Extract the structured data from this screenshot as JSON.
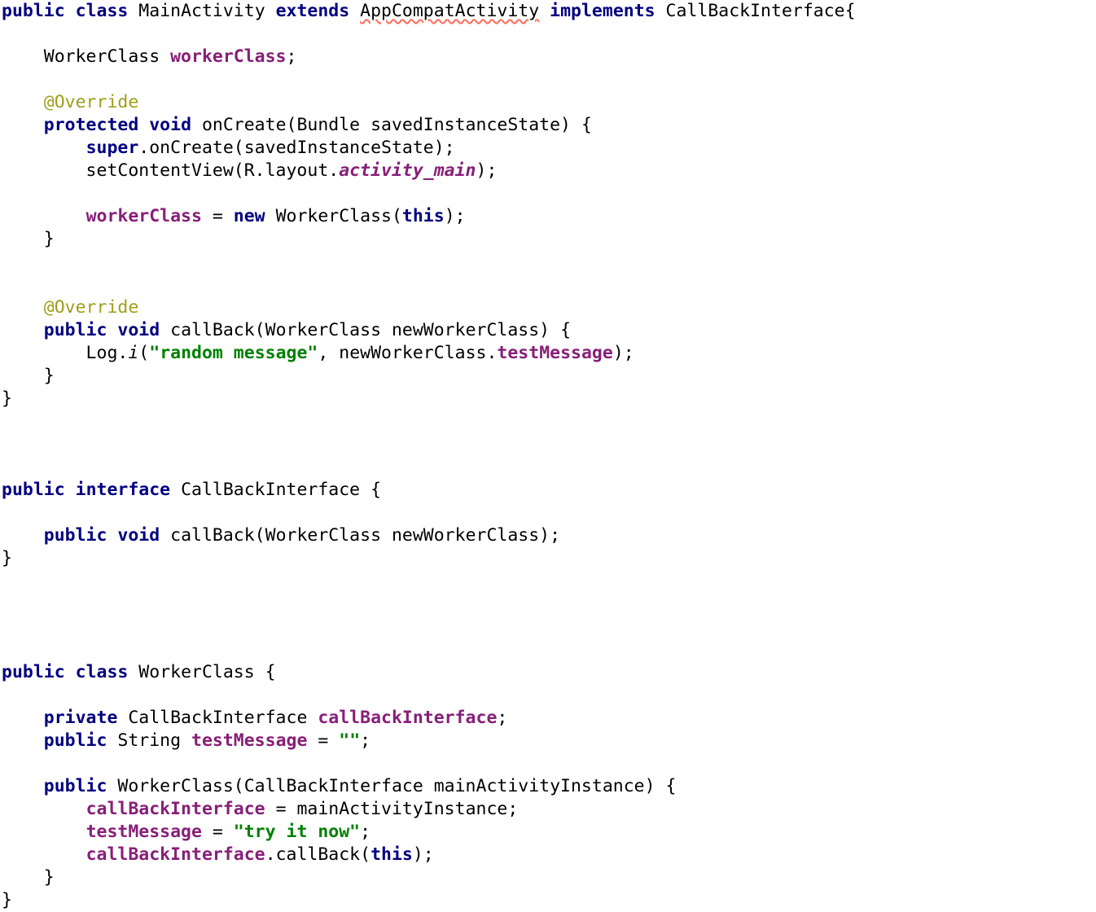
{
  "editor": {
    "language": "java",
    "background_color": "#ffffff",
    "font_size_px": 21.5,
    "line_height_px": 28,
    "theme": "light"
  },
  "colors": {
    "keyword": "#000080",
    "field": "#871F78",
    "static_field": "#871F78",
    "string": "#008000",
    "annotation": "#9E9E1A",
    "plain_text": "#000000",
    "error_squiggle": "#FF6B5A"
  },
  "code": {
    "lines": [
      {
        "n": 1,
        "tokens": [
          {
            "t": "public",
            "c": "kw"
          },
          {
            "t": " ",
            "c": "plain"
          },
          {
            "t": "class",
            "c": "kw"
          },
          {
            "t": " MainActivity ",
            "c": "plain"
          },
          {
            "t": "extends",
            "c": "kw"
          },
          {
            "t": " ",
            "c": "plain"
          },
          {
            "t": "AppCompatActivity",
            "c": "err"
          },
          {
            "t": " ",
            "c": "plain"
          },
          {
            "t": "implements",
            "c": "kw"
          },
          {
            "t": " CallBackInterface{",
            "c": "plain"
          }
        ]
      },
      {
        "n": 2,
        "tokens": []
      },
      {
        "n": 3,
        "tokens": [
          {
            "t": "    WorkerClass ",
            "c": "plain"
          },
          {
            "t": "workerClass",
            "c": "field"
          },
          {
            "t": ";",
            "c": "plain"
          }
        ]
      },
      {
        "n": 4,
        "tokens": []
      },
      {
        "n": 5,
        "tokens": [
          {
            "t": "    ",
            "c": "plain"
          },
          {
            "t": "@Override",
            "c": "anno"
          }
        ]
      },
      {
        "n": 6,
        "tokens": [
          {
            "t": "    ",
            "c": "plain"
          },
          {
            "t": "protected",
            "c": "kw"
          },
          {
            "t": " ",
            "c": "plain"
          },
          {
            "t": "void",
            "c": "kw"
          },
          {
            "t": " onCreate(Bundle savedInstanceState) {",
            "c": "plain"
          }
        ]
      },
      {
        "n": 7,
        "tokens": [
          {
            "t": "        ",
            "c": "plain"
          },
          {
            "t": "super",
            "c": "kw"
          },
          {
            "t": ".onCreate(savedInstanceState);",
            "c": "plain"
          }
        ]
      },
      {
        "n": 8,
        "tokens": [
          {
            "t": "        setContentView(R.layout.",
            "c": "plain"
          },
          {
            "t": "activity_main",
            "c": "static"
          },
          {
            "t": ");",
            "c": "plain"
          }
        ]
      },
      {
        "n": 9,
        "tokens": []
      },
      {
        "n": 10,
        "tokens": [
          {
            "t": "        ",
            "c": "plain"
          },
          {
            "t": "workerClass",
            "c": "field"
          },
          {
            "t": " = ",
            "c": "plain"
          },
          {
            "t": "new",
            "c": "kw"
          },
          {
            "t": " WorkerClass(",
            "c": "plain"
          },
          {
            "t": "this",
            "c": "kw"
          },
          {
            "t": ");",
            "c": "plain"
          }
        ]
      },
      {
        "n": 11,
        "tokens": [
          {
            "t": "    }",
            "c": "plain"
          }
        ]
      },
      {
        "n": 12,
        "tokens": []
      },
      {
        "n": 13,
        "tokens": []
      },
      {
        "n": 14,
        "tokens": [
          {
            "t": "    ",
            "c": "plain"
          },
          {
            "t": "@Override",
            "c": "anno"
          }
        ]
      },
      {
        "n": 15,
        "tokens": [
          {
            "t": "    ",
            "c": "plain"
          },
          {
            "t": "public",
            "c": "kw"
          },
          {
            "t": " ",
            "c": "plain"
          },
          {
            "t": "void",
            "c": "kw"
          },
          {
            "t": " callBack(WorkerClass newWorkerClass) {",
            "c": "plain"
          }
        ]
      },
      {
        "n": 16,
        "tokens": [
          {
            "t": "        Log.",
            "c": "plain"
          },
          {
            "t": "i",
            "c": "method"
          },
          {
            "t": "(",
            "c": "plain"
          },
          {
            "t": "\"random message\"",
            "c": "string"
          },
          {
            "t": ", newWorkerClass.",
            "c": "plain"
          },
          {
            "t": "testMessage",
            "c": "field"
          },
          {
            "t": ");",
            "c": "plain"
          }
        ]
      },
      {
        "n": 17,
        "tokens": [
          {
            "t": "    }",
            "c": "plain"
          }
        ]
      },
      {
        "n": 18,
        "tokens": [
          {
            "t": "}",
            "c": "plain"
          }
        ]
      },
      {
        "n": 19,
        "tokens": []
      },
      {
        "n": 20,
        "tokens": []
      },
      {
        "n": 21,
        "tokens": []
      },
      {
        "n": 22,
        "tokens": [
          {
            "t": "public",
            "c": "kw"
          },
          {
            "t": " ",
            "c": "plain"
          },
          {
            "t": "interface",
            "c": "kw"
          },
          {
            "t": " CallBackInterface {",
            "c": "plain"
          }
        ]
      },
      {
        "n": 23,
        "tokens": []
      },
      {
        "n": 24,
        "tokens": [
          {
            "t": "    ",
            "c": "plain"
          },
          {
            "t": "public",
            "c": "kw"
          },
          {
            "t": " ",
            "c": "plain"
          },
          {
            "t": "void",
            "c": "kw"
          },
          {
            "t": " callBack(WorkerClass newWorkerClass);",
            "c": "plain"
          }
        ]
      },
      {
        "n": 25,
        "tokens": [
          {
            "t": "}",
            "c": "plain"
          }
        ]
      },
      {
        "n": 26,
        "tokens": []
      },
      {
        "n": 27,
        "tokens": []
      },
      {
        "n": 28,
        "tokens": []
      },
      {
        "n": 29,
        "tokens": []
      },
      {
        "n": 30,
        "tokens": [
          {
            "t": "public",
            "c": "kw"
          },
          {
            "t": " ",
            "c": "plain"
          },
          {
            "t": "class",
            "c": "kw"
          },
          {
            "t": " WorkerClass {",
            "c": "plain"
          }
        ]
      },
      {
        "n": 31,
        "tokens": []
      },
      {
        "n": 32,
        "tokens": [
          {
            "t": "    ",
            "c": "plain"
          },
          {
            "t": "private",
            "c": "kw"
          },
          {
            "t": " CallBackInterface ",
            "c": "plain"
          },
          {
            "t": "callBackInterface",
            "c": "field"
          },
          {
            "t": ";",
            "c": "plain"
          }
        ]
      },
      {
        "n": 33,
        "tokens": [
          {
            "t": "    ",
            "c": "plain"
          },
          {
            "t": "public",
            "c": "kw"
          },
          {
            "t": " String ",
            "c": "plain"
          },
          {
            "t": "testMessage",
            "c": "field"
          },
          {
            "t": " = ",
            "c": "plain"
          },
          {
            "t": "\"\"",
            "c": "string"
          },
          {
            "t": ";",
            "c": "plain"
          }
        ]
      },
      {
        "n": 34,
        "tokens": []
      },
      {
        "n": 35,
        "tokens": [
          {
            "t": "    ",
            "c": "plain"
          },
          {
            "t": "public",
            "c": "kw"
          },
          {
            "t": " WorkerClass(CallBackInterface mainActivityInstance) {",
            "c": "plain"
          }
        ]
      },
      {
        "n": 36,
        "tokens": [
          {
            "t": "        ",
            "c": "plain"
          },
          {
            "t": "callBackInterface",
            "c": "field"
          },
          {
            "t": " = mainActivityInstance;",
            "c": "plain"
          }
        ]
      },
      {
        "n": 37,
        "tokens": [
          {
            "t": "        ",
            "c": "plain"
          },
          {
            "t": "testMessage",
            "c": "field"
          },
          {
            "t": " = ",
            "c": "plain"
          },
          {
            "t": "\"try it now\"",
            "c": "string"
          },
          {
            "t": ";",
            "c": "plain"
          }
        ]
      },
      {
        "n": 38,
        "tokens": [
          {
            "t": "        ",
            "c": "plain"
          },
          {
            "t": "callBackInterface",
            "c": "field"
          },
          {
            "t": ".callBack(",
            "c": "plain"
          },
          {
            "t": "this",
            "c": "kw"
          },
          {
            "t": ");",
            "c": "plain"
          }
        ]
      },
      {
        "n": 39,
        "tokens": [
          {
            "t": "    }",
            "c": "plain"
          }
        ]
      },
      {
        "n": 40,
        "tokens": [
          {
            "t": "}",
            "c": "plain"
          }
        ]
      }
    ]
  }
}
